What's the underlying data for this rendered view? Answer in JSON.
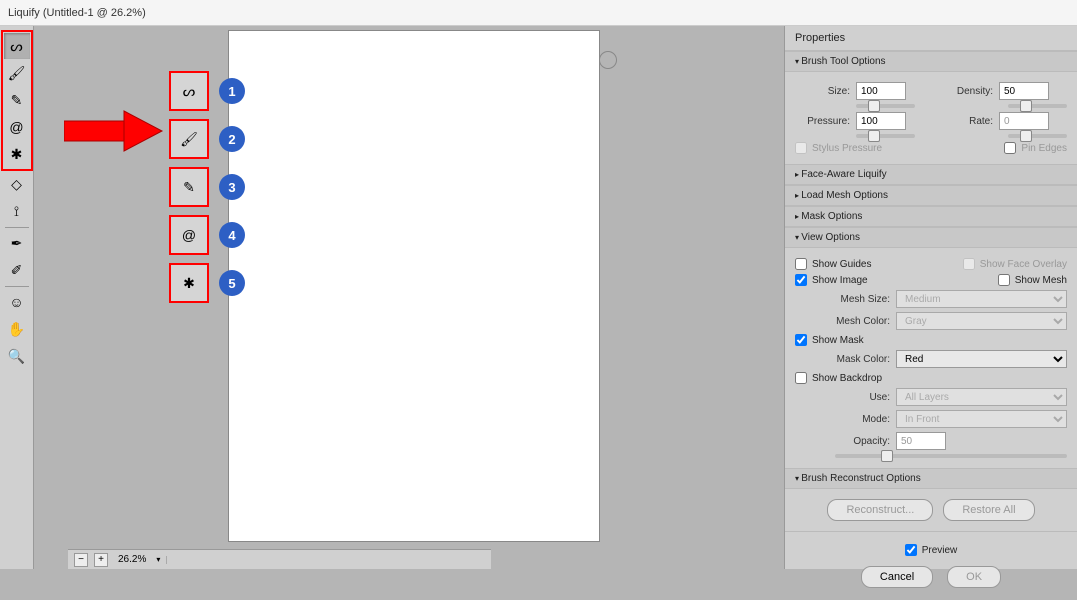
{
  "title": "Liquify (Untitled-1 @ 26.2%)",
  "zoom": "26.2%",
  "callouts": [
    "1",
    "2",
    "3",
    "4",
    "5"
  ],
  "panel": {
    "title": "Properties",
    "sections": {
      "brush_tool": "Brush Tool Options",
      "face_aware": "Face-Aware Liquify",
      "load_mesh": "Load Mesh Options",
      "mask": "Mask Options",
      "view": "View Options",
      "reconstruct": "Brush Reconstruct Options"
    },
    "brush": {
      "size_label": "Size:",
      "size": "100",
      "density_label": "Density:",
      "density": "50",
      "pressure_label": "Pressure:",
      "pressure": "100",
      "rate_label": "Rate:",
      "rate": "0",
      "stylus": "Stylus Pressure",
      "pin": "Pin Edges"
    },
    "view": {
      "show_guides": "Show Guides",
      "show_face_overlay": "Show Face Overlay",
      "show_image": "Show Image",
      "show_mesh": "Show Mesh",
      "mesh_size_label": "Mesh Size:",
      "mesh_size": "Medium",
      "mesh_color_label": "Mesh Color:",
      "mesh_color": "Gray",
      "show_mask": "Show Mask",
      "mask_color_label": "Mask Color:",
      "mask_color": "Red",
      "show_backdrop": "Show Backdrop",
      "use_label": "Use:",
      "use": "All Layers",
      "mode_label": "Mode:",
      "mode": "In Front",
      "opacity_label": "Opacity:",
      "opacity": "50"
    },
    "reconstruct_btn": "Reconstruct...",
    "restore_btn": "Restore All",
    "preview": "Preview",
    "cancel": "Cancel",
    "ok": "OK"
  }
}
